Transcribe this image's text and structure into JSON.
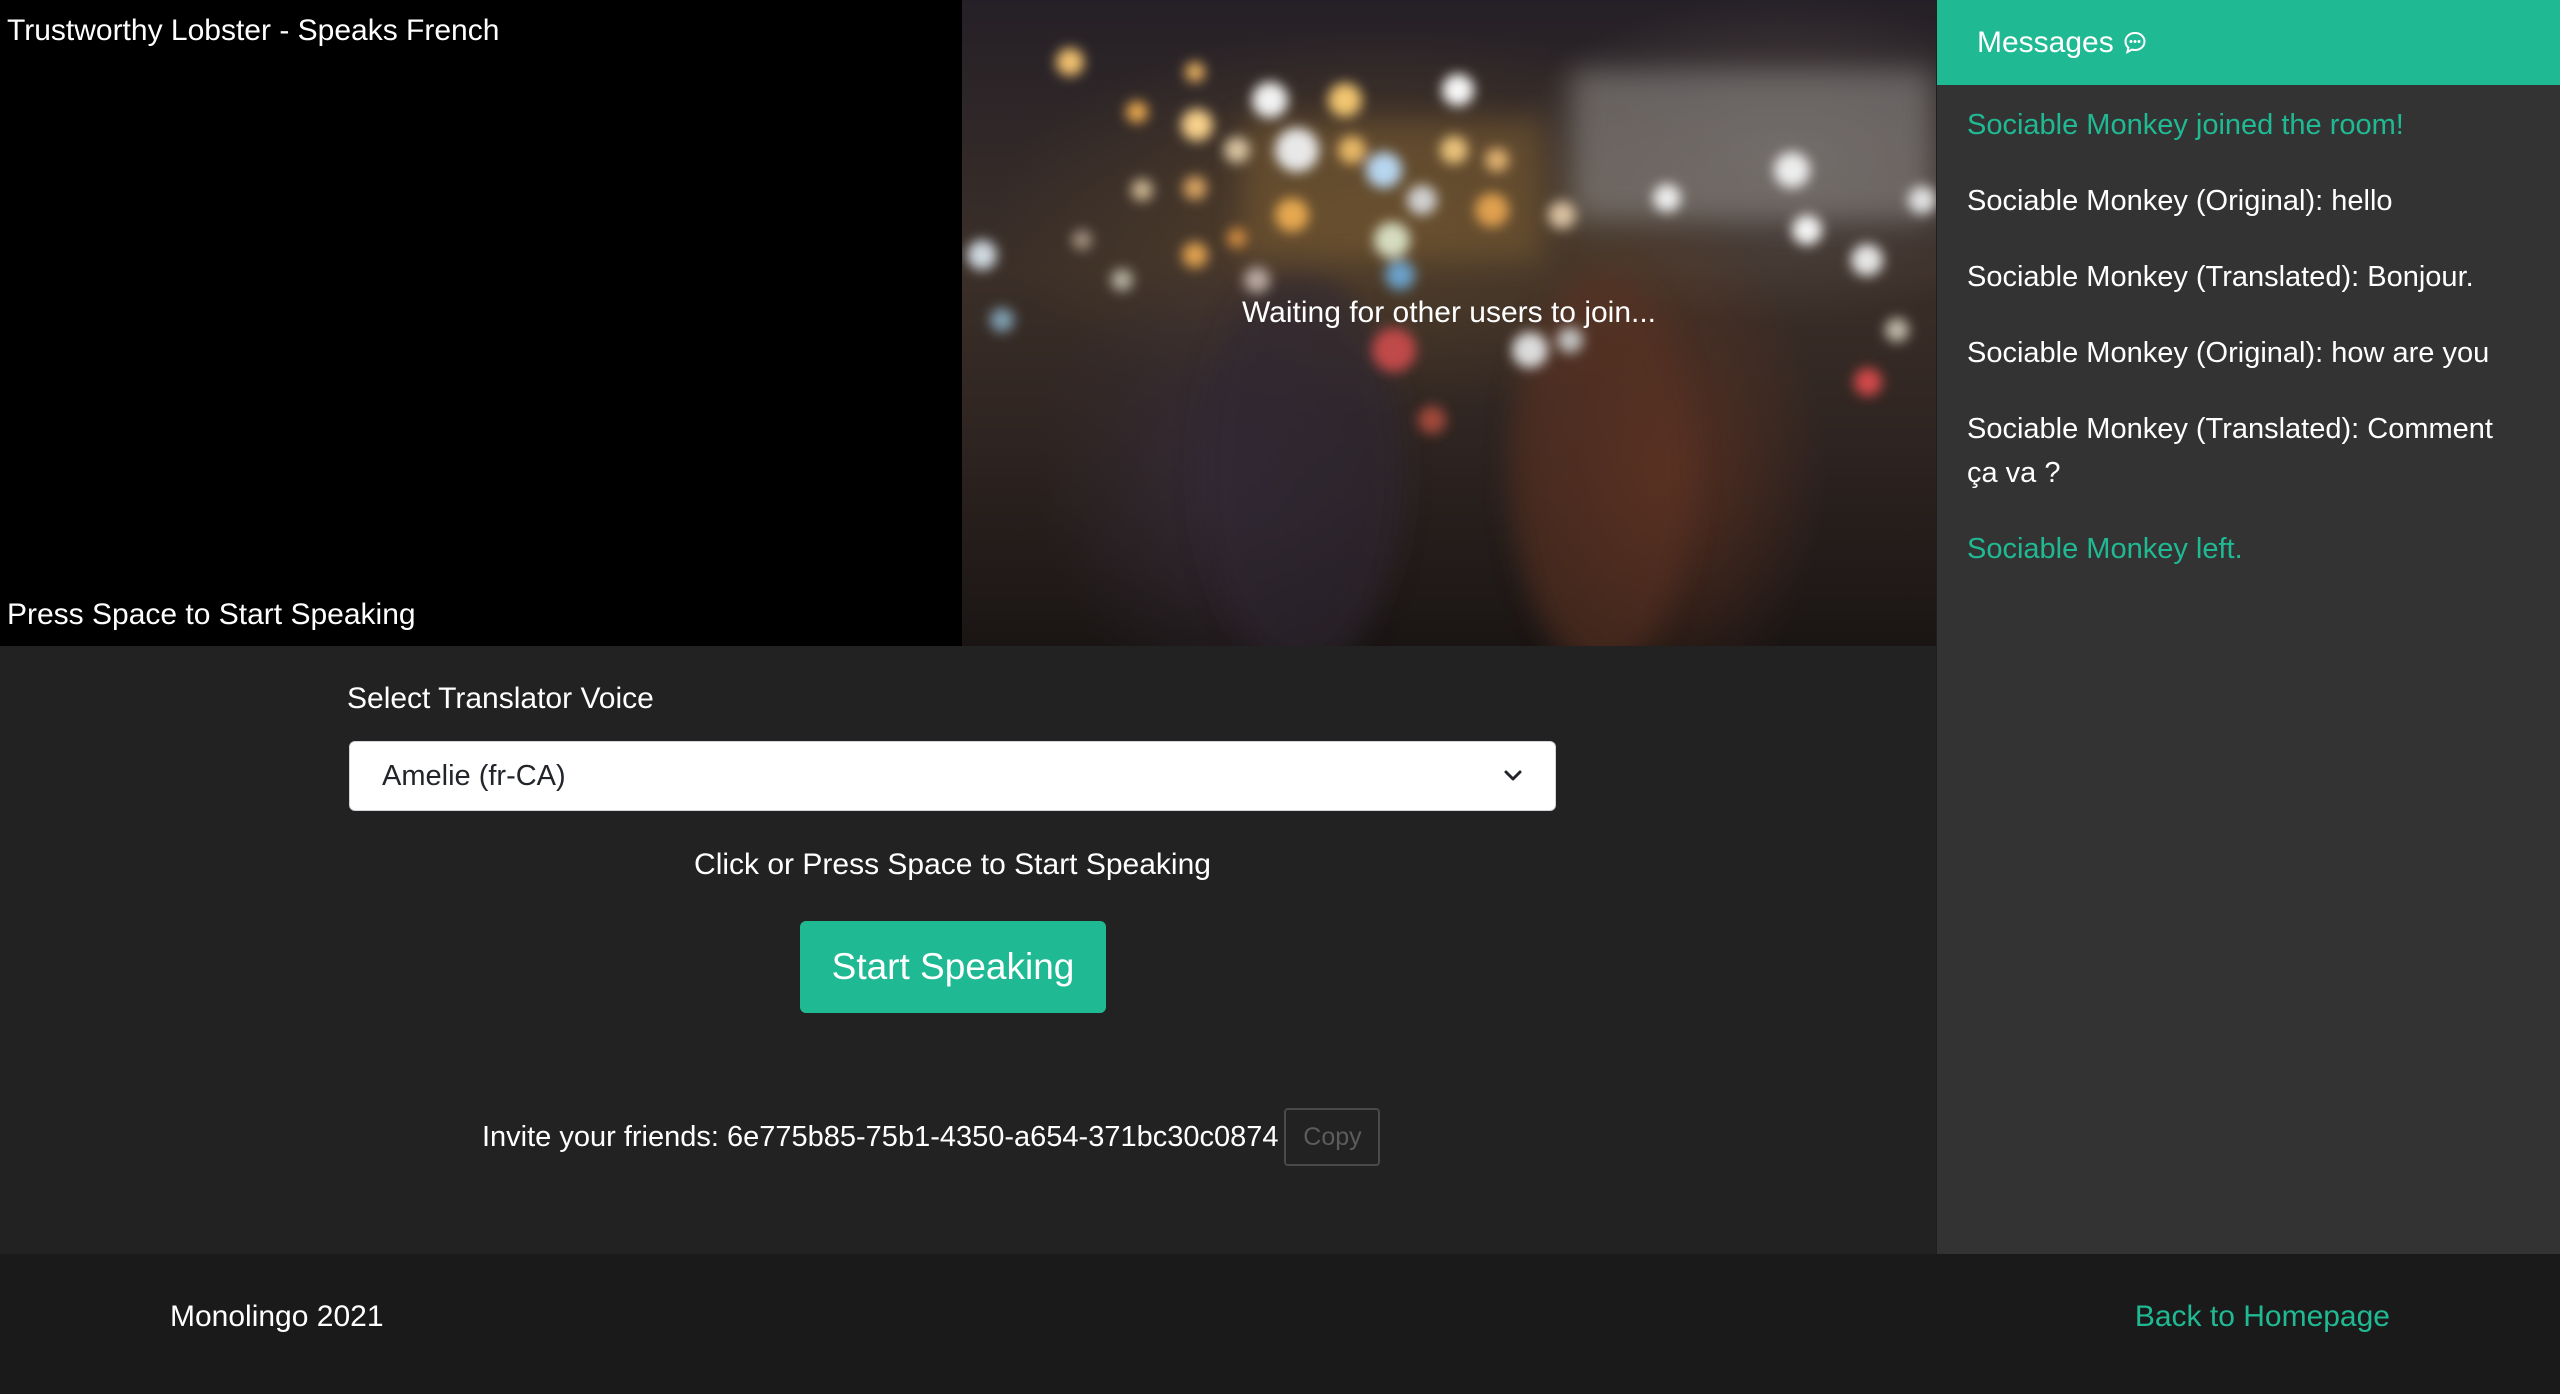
{
  "local_video": {
    "user_label": "Trustworthy Lobster - Speaks French",
    "hint": "Press Space to Start Speaking"
  },
  "remote_video": {
    "status": "Waiting for other users to join..."
  },
  "messages": {
    "title": "Messages",
    "icon": "chat-bubble-icon",
    "items": [
      {
        "text": "Sociable Monkey joined the room!",
        "kind": "system"
      },
      {
        "text": "Sociable Monkey (Original): hello",
        "kind": "user"
      },
      {
        "text": "Sociable Monkey (Translated): Bonjour.",
        "kind": "user"
      },
      {
        "text": "Sociable Monkey (Original): how are you",
        "kind": "user"
      },
      {
        "text": "Sociable Monkey (Translated): Comment ça va ?",
        "kind": "user"
      },
      {
        "text": "Sociable Monkey left.",
        "kind": "system"
      }
    ]
  },
  "controls": {
    "voice_label": "Select Translator Voice",
    "voice_selected": "Amelie (fr-CA)",
    "speak_hint": "Click or Press Space to Start Speaking",
    "speak_button": "Start Speaking",
    "invite_text": "Invite your friends: 6e775b85-75b1-4350-a654-371bc30c0874",
    "copy_button": "Copy"
  },
  "footer": {
    "brand": "Monolingo 2021",
    "home_link": "Back to Homepage"
  },
  "colors": {
    "accent": "#1fba93",
    "panel": "#333333",
    "background": "#222222",
    "footer": "#1a1a1a"
  }
}
